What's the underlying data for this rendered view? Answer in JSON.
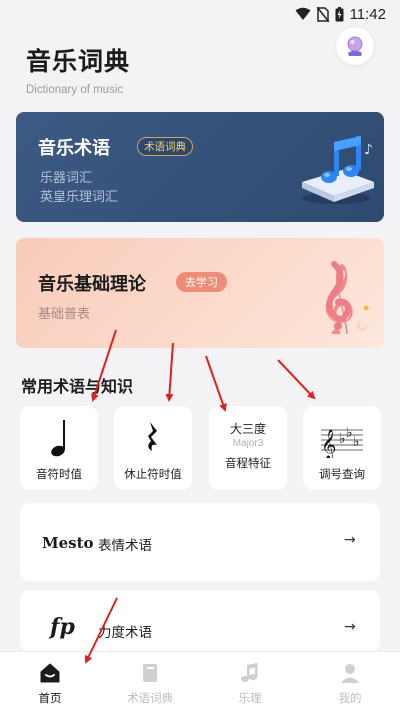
{
  "status_bar": {
    "time": "11:42",
    "icons": [
      "wifi-icon",
      "no-sim-icon",
      "battery-charging-icon"
    ]
  },
  "header": {
    "title": "音乐词典",
    "subtitle": "Dictionary of music",
    "avatar_icon": "crystal-ball-avatar-icon"
  },
  "terms_card": {
    "title": "音乐术语",
    "tag": "术语词典",
    "lines": [
      "乐器词汇",
      "英皇乐理词汇"
    ],
    "art_icon": "music-note-3d-icon",
    "bg_color": "#34507a"
  },
  "theory_card": {
    "title": "音乐基础理论",
    "tag": "去学习",
    "subtitle": "基础普表",
    "art_icon": "treble-clef-3d-icon",
    "bg_color": "#fad3c4"
  },
  "section": {
    "title": "常用术语与知识"
  },
  "tiles": [
    {
      "label": "音符时值",
      "icon": "quarter-note-icon"
    },
    {
      "label": "休止符时值",
      "icon": "quarter-rest-icon"
    },
    {
      "label": "音程特征",
      "big": "大三度",
      "small": "Major3"
    },
    {
      "label": "调号查询",
      "icon": "key-signature-icon"
    }
  ],
  "rows": [
    {
      "mark": "Mesto",
      "label": "表情术语",
      "arrow": "→"
    },
    {
      "mark": "fp",
      "label": "力度术语",
      "arrow": "→"
    }
  ],
  "tabbar": {
    "items": [
      {
        "label": "首页",
        "icon": "home-icon",
        "active": true
      },
      {
        "label": "术语词典",
        "icon": "book-icon",
        "active": false
      },
      {
        "label": "乐理",
        "icon": "music-note-icon",
        "active": false
      },
      {
        "label": "我的",
        "icon": "user-icon",
        "active": false
      }
    ]
  },
  "annotation_color": "#e02020"
}
